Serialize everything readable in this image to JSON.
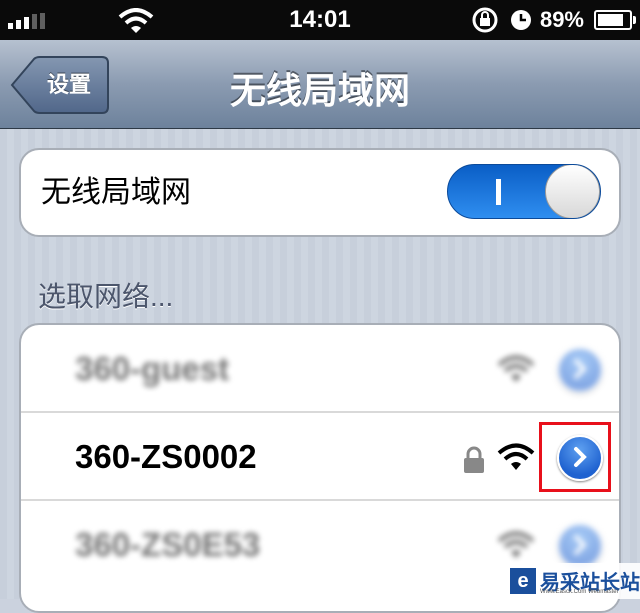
{
  "status_bar": {
    "time": "14:01",
    "battery_percent": "89%",
    "battery_level": 0.89,
    "icons": [
      "signal-icon",
      "wifi-icon",
      "rotation-lock-icon",
      "alarm-icon",
      "battery-icon"
    ]
  },
  "navbar": {
    "back_label": "设置",
    "title": "无线局域网"
  },
  "wifi_toggle": {
    "label": "无线局域网",
    "state": "on",
    "on_symbol": "I"
  },
  "section_header": "选取网络...",
  "networks": [
    {
      "name": "360-guest",
      "locked": false,
      "blurred": true
    },
    {
      "name": "360-ZS0002",
      "locked": true,
      "blurred": false
    },
    {
      "name": "360-ZS0E53",
      "locked": false,
      "blurred": true
    }
  ],
  "watermark": {
    "text": "易采站长站",
    "subtext": "Www.Easck.Com Webmaster"
  },
  "colors": {
    "switch_on": "#1f77e4",
    "highlight_box": "#e8101b",
    "nav_bar": "#8b9bb1",
    "detail_button": "#1f62d0"
  }
}
